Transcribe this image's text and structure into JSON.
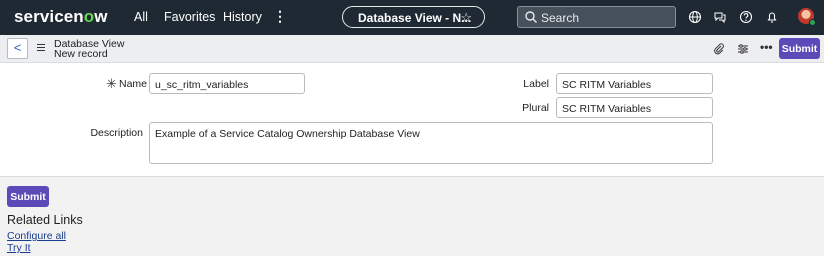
{
  "topnav": {
    "logo_prefix": "servicen",
    "logo_o": "o",
    "logo_suffix": "w",
    "links": [
      "All",
      "Favorites",
      "History"
    ],
    "more_label": "⋮",
    "record_pill": "Database View - N...",
    "search_placeholder": "Search",
    "icons": [
      "globe-icon",
      "chat-icon",
      "help-icon",
      "bell-icon",
      "avatar"
    ]
  },
  "form_header": {
    "title": "Database View",
    "subtitle": "New record",
    "back_label": "<",
    "more_label": "•••",
    "submit_label": "Submit"
  },
  "form": {
    "name_label": "Name",
    "name_value": "u_sc_ritm_variables",
    "label_label": "Label",
    "label_value": "SC RITM Variables",
    "plural_label": "Plural",
    "plural_value": "SC RITM Variables",
    "description_label": "Description",
    "description_value": "Example of a Service Catalog Ownership Database View",
    "mandatory_mark": "✳"
  },
  "footer": {
    "submit_label": "Submit",
    "related_links_heading": "Related Links",
    "links": [
      "Configure all",
      "Try It"
    ]
  },
  "colors": {
    "nav_bg": "#1f2933",
    "accent": "#5b4ab8",
    "logo_green": "#62d84e"
  }
}
